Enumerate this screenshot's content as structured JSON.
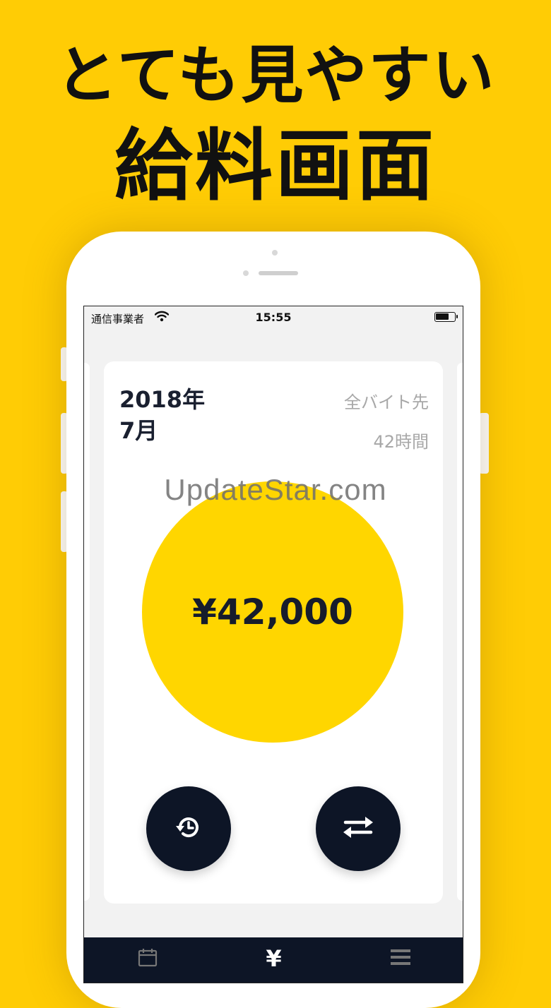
{
  "headline": {
    "line1": "とても見やすい",
    "line2": "給料画面"
  },
  "status_bar": {
    "carrier": "通信事業者",
    "time": "15:55"
  },
  "summary_card": {
    "period_year": "2018年",
    "period_month": "7月",
    "scope": "全バイト先",
    "hours": "42時間",
    "amount": "¥42,000"
  },
  "actions": {
    "history": "history-icon",
    "switch": "swap-arrows-icon"
  },
  "tab_bar": {
    "tabs": [
      {
        "icon": "calendar-icon"
      },
      {
        "icon": "yen-icon",
        "label": "¥"
      },
      {
        "icon": "menu-icon"
      }
    ]
  },
  "watermark": "UpdateStar.com",
  "colors": {
    "background": "#FFCC05",
    "accent_circle": "#FFD600",
    "navy": "#0D1526"
  }
}
